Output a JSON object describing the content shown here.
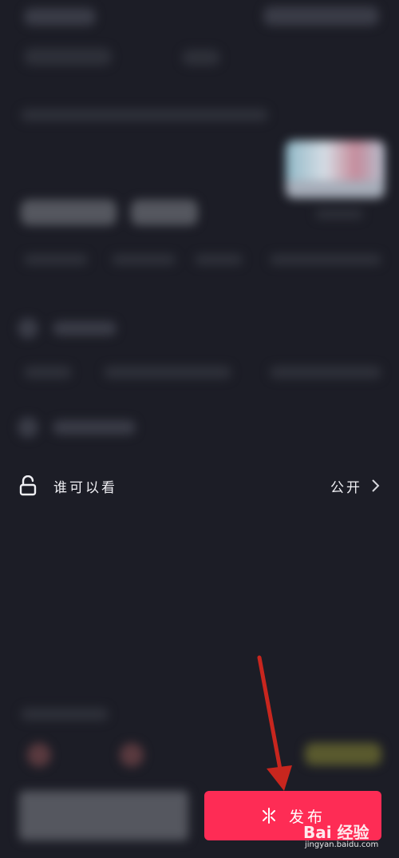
{
  "visibility_row": {
    "label": "谁可以看",
    "value": "公开",
    "lock_icon": "lock-icon",
    "chevron_icon": "chevron-right-icon"
  },
  "publish_button": {
    "label": "发布",
    "icon": "sparkle-icon",
    "color": "#fe2c55"
  },
  "annotation": {
    "arrow_color": "#c8261e"
  },
  "watermark": {
    "logo_text": "Bai 经验",
    "url": "jingyan.baidu.com"
  },
  "colors": {
    "background": "#1c1d26"
  }
}
